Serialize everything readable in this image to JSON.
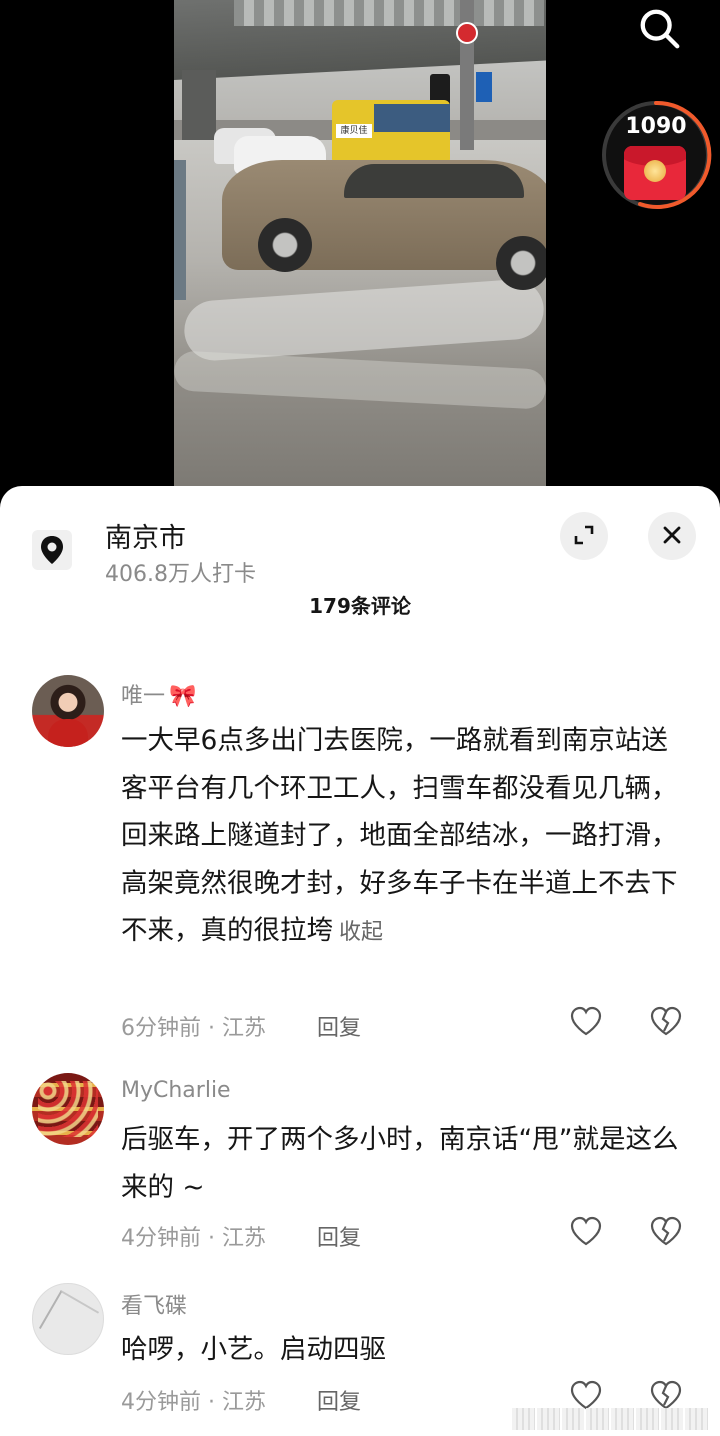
{
  "video": {
    "bus_sign": "康贝佳"
  },
  "top_right": {
    "redpacket_count": "1090"
  },
  "sheet": {
    "location_title": "南京市",
    "location_sub": "406.8万人打卡",
    "comment_count": "179条评论"
  },
  "comments": [
    {
      "name": "唯一",
      "name_decoration": "🎀",
      "text": "一大早6点多出门去医院，一路就看到南京站送客平台有几个环卫工人，扫雪车都没看见几辆，回来路上隧道封了，地面全部结冰，一路打滑，高架竟然很晚才封，好多车子卡在半道上不去下不来，真的很拉垮",
      "fold_label": "收起",
      "meta": "6分钟前 · 江苏",
      "reply": "回复"
    },
    {
      "name": "MyCharlie",
      "text": "后驱车，开了两个多小时，南京话“甩”就是这么来的 ~",
      "meta": "4分钟前 · 江苏",
      "reply": "回复"
    },
    {
      "name": "看飞碟",
      "text": "哈啰，小艺。启动四驱",
      "meta": "4分钟前 · 江苏",
      "reply": "回复"
    }
  ],
  "icons": {
    "search": "search-icon",
    "location": "location-pin-icon",
    "expand": "expand-icon",
    "close": "close-icon",
    "like": "heart-icon",
    "dislike": "broken-heart-icon"
  },
  "colors": {
    "redpacket": "#e8283a",
    "ring": "#f05a2c",
    "text_primary": "#161616",
    "text_secondary": "#8a8a8a"
  }
}
